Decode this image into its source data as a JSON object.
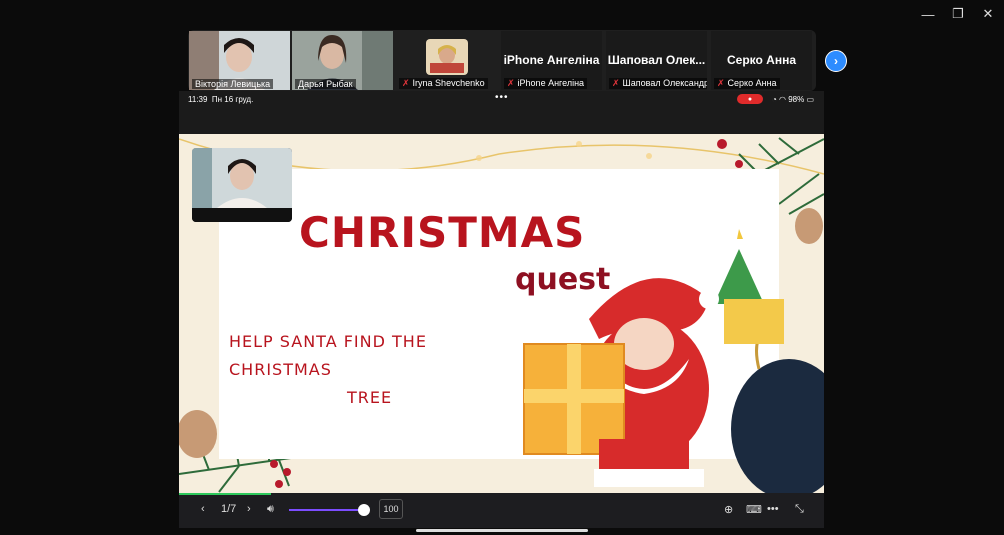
{
  "window_controls": {
    "minimize": "—",
    "restore": "❐",
    "close": "✕"
  },
  "participants": [
    {
      "name": "Вікторія Левицька",
      "muted": false,
      "video": true,
      "active": false
    },
    {
      "name": "Дарья Рыбак",
      "muted": false,
      "video": true,
      "active": true
    },
    {
      "name": "Iryna Shevchenko",
      "muted": true,
      "video": true,
      "active": false
    },
    {
      "name": "iPhone Ангеліна",
      "display_name": "iPhone Ангеліна",
      "muted": true,
      "video": false,
      "active": false
    },
    {
      "name": "Шаповал Олександра",
      "display_name": "Шаповал Олек...",
      "muted": true,
      "video": false,
      "active": false
    },
    {
      "name": "Серко Анна",
      "display_name": "Серко Анна",
      "muted": true,
      "video": false,
      "active": false
    }
  ],
  "next_page_icon": "chevron-right-icon",
  "ipad": {
    "time": "11:39",
    "date": "Пн 16 груд.",
    "menu_dots": "•••",
    "battery": "98%"
  },
  "slide": {
    "title": "CHRISTMAS",
    "subtitle": "quest",
    "instruction_line1": "HELP SANTA FIND THE CHRISTMAS",
    "instruction_line2": "TREE"
  },
  "toolbar": {
    "prev": "‹",
    "page": "1/7",
    "next": "›",
    "volume_level": 1.0,
    "zoom_value": "100"
  },
  "colors": {
    "active_speaker": "#2ec95c",
    "accent": "#2d8cff",
    "title_red": "#b8141e"
  }
}
